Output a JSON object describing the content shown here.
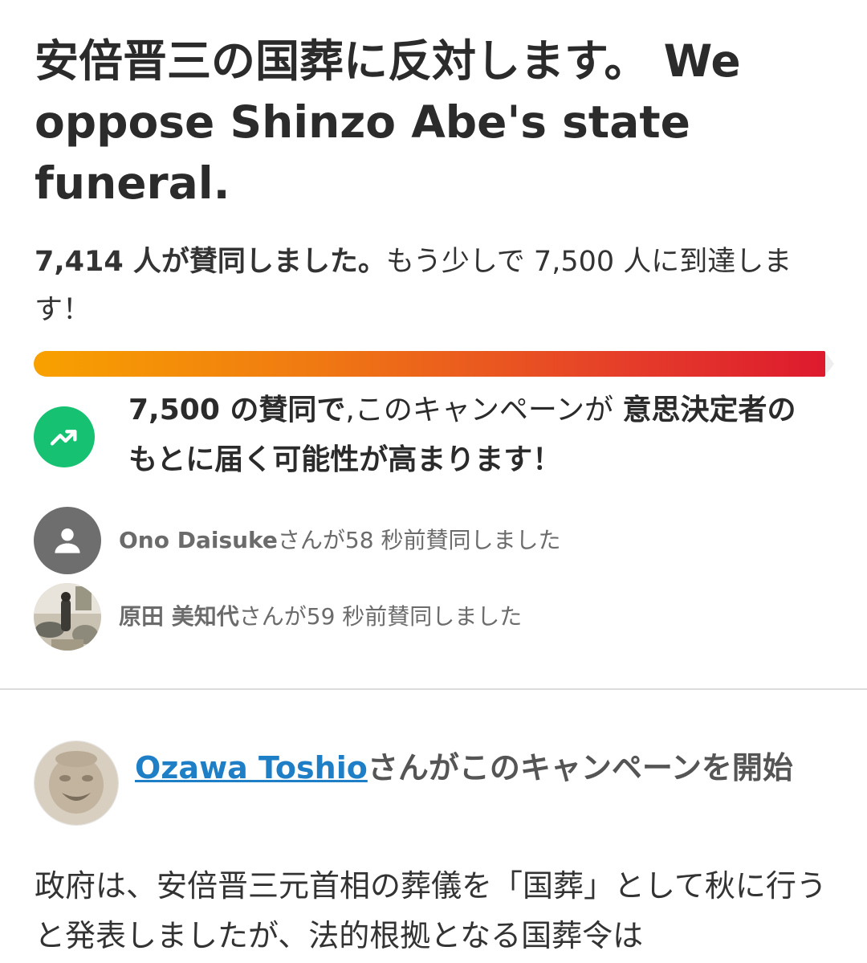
{
  "petition": {
    "title": "安倍晋三の国葬に反対します。 We oppose Shinzo Abe's state funeral."
  },
  "signatures": {
    "count_label": "7,414 人が賛同しました。",
    "goal_message": "もう少しで 7,500 人に到達します！",
    "progress_fraction": 0.9885
  },
  "milestone": {
    "lead_bold": "7,500 の賛同で",
    "middle": ",このキャンペーンが ",
    "tail_bold": "意思決定者のもとに届く可能性が高まります！",
    "icon": "trending-up-icon"
  },
  "recent_signers": [
    {
      "name": "Ono Daisuke",
      "suffix": "さんが58 秒前賛同しました",
      "avatar": "default-user-icon"
    },
    {
      "name": "原田 美知代",
      "suffix": "さんが59 秒前賛同しました",
      "avatar": "photo"
    }
  ],
  "starter": {
    "name": "Ozawa Toshio",
    "suffix": "さんがこのキャンペーンを開始"
  },
  "description": {
    "text": "政府は、安倍晋三元首相の葬儀を「国葬」として秋に行うと発表しましたが、法的根拠となる国葬令は"
  },
  "colors": {
    "progress_start": "#f8a100",
    "progress_end": "#dd1a2e",
    "trend_badge": "#16c172",
    "link": "#1f7fc6",
    "default_avatar": "#6e6e6e"
  }
}
